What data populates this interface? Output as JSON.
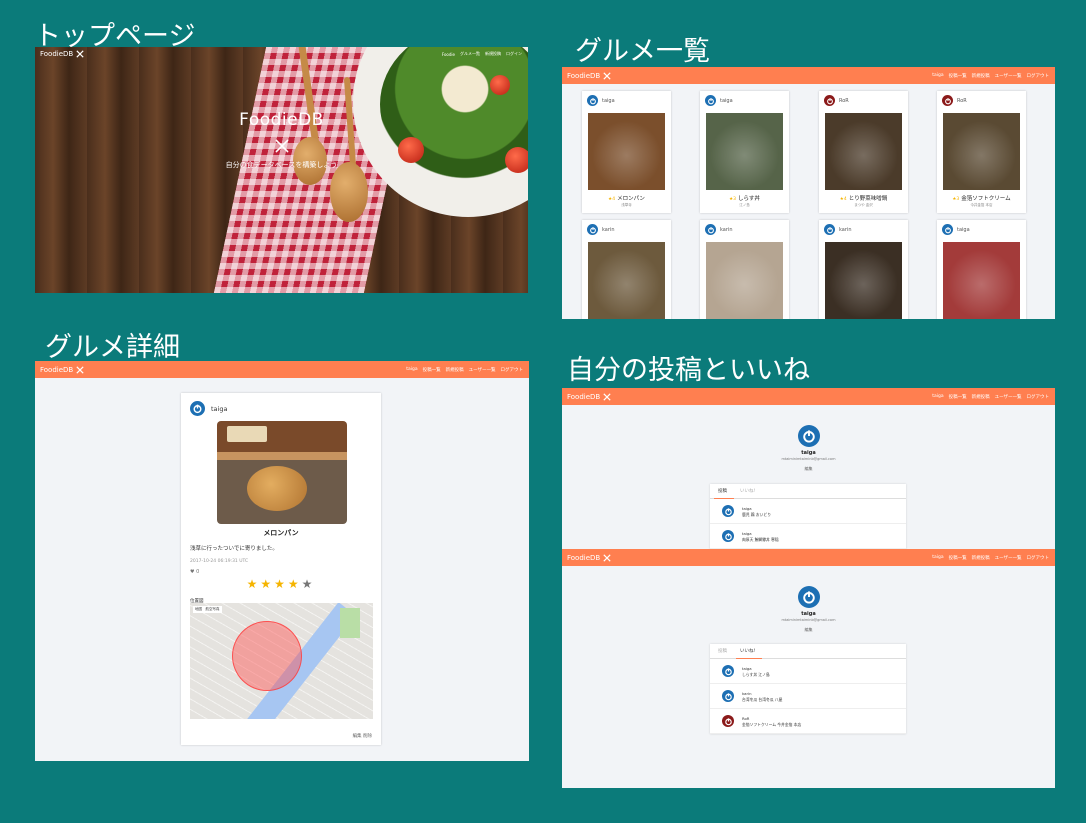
{
  "sections": {
    "top": "トップページ",
    "list": "グルメ一覧",
    "detail": "グルメ詳細",
    "posts": "自分の投稿といいね"
  },
  "brand": "FoodieDB",
  "nav_top": [
    "Foodie",
    "グルメ一覧",
    "新規投稿",
    "ログイン"
  ],
  "nav": [
    "taiga",
    "投稿一覧",
    "新規投稿",
    "ユーザー一覧",
    "ログアウト"
  ],
  "hero": {
    "title": "FoodieDB",
    "subtitle": "自分の食データベースを構築しよう"
  },
  "cards": [
    {
      "user": "taiga",
      "title": "メロンパン",
      "sub": "浅草寺",
      "stars": "★4",
      "avatar": "blue",
      "img": "#7b4f2c"
    },
    {
      "user": "taiga",
      "title": "しらす丼",
      "sub": "江ノ島",
      "stars": "★3",
      "avatar": "blue",
      "img": "#566449"
    },
    {
      "user": "RoR",
      "title": "とり野菜味噌鍋",
      "sub": "まつや 金沢",
      "stars": "★4",
      "avatar": "red",
      "img": "#4b3b2a"
    },
    {
      "user": "RoR",
      "title": "金箔ソフトクリーム",
      "sub": "今井金箔 本店",
      "stars": "★3",
      "avatar": "red",
      "img": "#5a4a33"
    },
    {
      "user": "karin",
      "avatar": "blue",
      "img": "#6d5a3d"
    },
    {
      "user": "karin",
      "avatar": "blue",
      "img": "#b5a592"
    },
    {
      "user": "karin",
      "avatar": "blue",
      "img": "#3b2f24"
    },
    {
      "user": "taiga",
      "avatar": "blue",
      "img": "#a33b3a"
    }
  ],
  "detail": {
    "user": "taiga",
    "title": "メロンパン",
    "text": "浅草に行ったついでに寄りました。",
    "date": "2017-10-24 06:19:31 UTC",
    "likes": "0",
    "stars_on": 4,
    "stars_total": 5,
    "map_label": "位置図",
    "map_type": "地図　航空写真",
    "actions": "編集 削除"
  },
  "profile": {
    "name": "taiga",
    "email": "mtaiminimtaiminb@gmail.com",
    "edit": "編集",
    "tab_posts": "投稿",
    "tab_likes": "いいね!"
  },
  "posts_rows": [
    {
      "name": "taiga",
      "detail": "鹿児 鶏 おいどり",
      "avatar": "blue"
    },
    {
      "name": "taiga",
      "detail": "肉厚天 鮪鰤鯵丼 寒稲",
      "avatar": "blue"
    }
  ],
  "likes_rows": [
    {
      "name": "taiga",
      "detail": "しらす丼 江ノ島",
      "avatar": "blue"
    },
    {
      "name": "karin",
      "detail": "台湾冬瓜 台湾冬瓜 八屋",
      "avatar": "blue"
    },
    {
      "name": "RoR",
      "detail": "金箔ソフトクリーム 今井金箔 本店",
      "avatar": "red"
    }
  ]
}
